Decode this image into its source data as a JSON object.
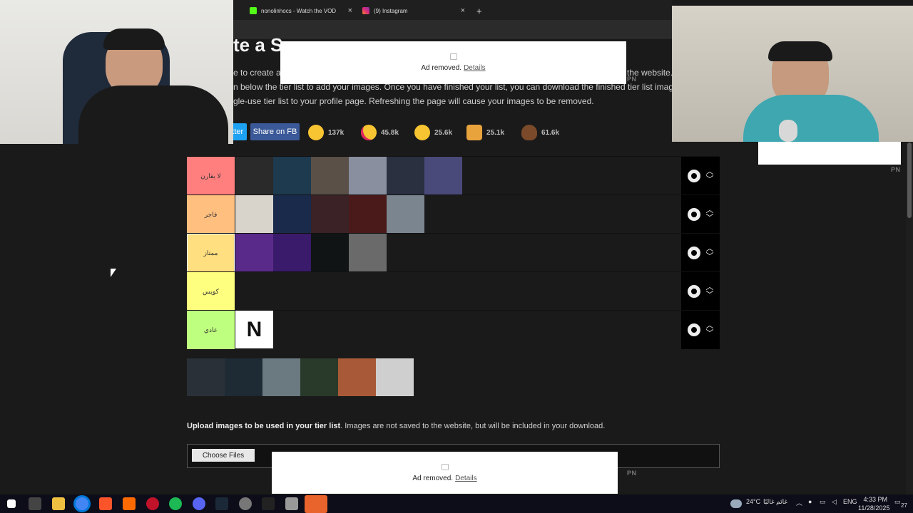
{
  "browser": {
    "tabs": [
      {
        "title": "nonolinhocs - Watch the VOD",
        "close": "×"
      },
      {
        "title": "(9) Instagram",
        "close": "×"
      }
    ],
    "new_tab": "+"
  },
  "page": {
    "title": "te a S",
    "intro_lines": [
      "e to create a s",
      "n below the tier list to add your images. Once you have finished your list, you can download the finished tier list image. It is",
      "gle-use tier list to your profile page. Refreshing the page will cause your images to be removed."
    ],
    "intro_tail": "the website.",
    "share_twitter": "itter",
    "share_fb": "Share on FB",
    "reactions": [
      {
        "icon": "grin-emoji-icon",
        "count": "137k"
      },
      {
        "icon": "heart-eyes-emoji-icon",
        "count": "45.8k"
      },
      {
        "icon": "laughing-emoji-icon",
        "count": "25.6k"
      },
      {
        "icon": "raised-hands-emoji-icon",
        "count": "25.1k"
      },
      {
        "icon": "poop-emoji-icon",
        "count": "61.6k"
      }
    ],
    "tiers": [
      {
        "label": "لا يقارن",
        "color": "#ff7f7f",
        "image_count": 6
      },
      {
        "label": "فاجر",
        "color": "#ffbf7f",
        "image_count": 5
      },
      {
        "label": "ممتاز",
        "color": "#ffdf7f",
        "image_count": 4
      },
      {
        "label": "كويس",
        "color": "#ffff7f",
        "image_count": 0
      },
      {
        "label": "عادي",
        "color": "#bfff7f",
        "image_count": 1
      }
    ],
    "pool_count": 6,
    "upload_bold": "Upload images to be used in your tier list",
    "upload_text": ". Images are not saved to the website, but will be included in your download.",
    "choose_files": "Choose Files"
  },
  "ads": [
    {
      "text": "Ad removed.",
      "link": "Details",
      "badge": "PN"
    },
    {
      "text": "Ad removed.",
      "link": "Details",
      "badge": "PN"
    }
  ],
  "side_badge": "PN",
  "taskbar": {
    "weather": "24°C",
    "weather_text": "غائم غالبًا",
    "lang": "ENG",
    "time": "4:33 PM",
    "date": "11/28/2025",
    "notif_count": "27"
  }
}
